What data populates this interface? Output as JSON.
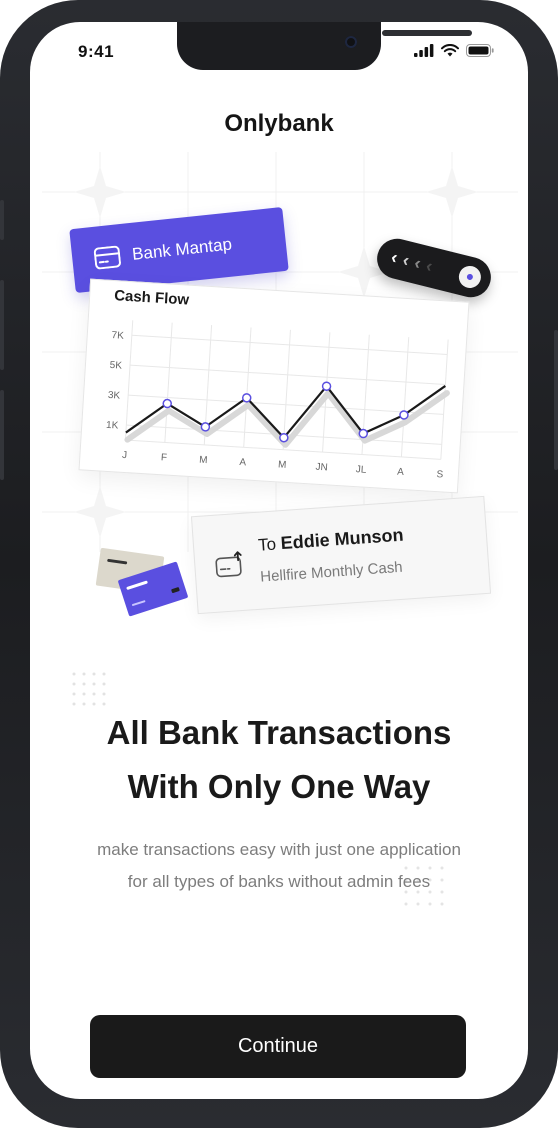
{
  "status_bar": {
    "time": "9:41"
  },
  "app": {
    "title": "Onlybank"
  },
  "bank_card": {
    "label": "Bank Mantap"
  },
  "cash_flow": {
    "title": "Cash Flow"
  },
  "transfer": {
    "prefix": "To",
    "name": "Eddie Munson",
    "note": "Hellfire Monthly Cash"
  },
  "onboarding": {
    "headline_line1": "All Bank Transactions",
    "headline_line2": "With Only One Way",
    "subtext_line1": "make transactions easy with just one application",
    "subtext_line2": "for all types of banks without admin fees",
    "continue_label": "Continue"
  },
  "colors": {
    "accent": "#5a4fe0",
    "button": "#1a1a1a",
    "text": "#1a1a1a",
    "muted": "#7d7d7d"
  },
  "chart_data": {
    "type": "line",
    "title": "Cash Flow",
    "categories": [
      "J",
      "F",
      "M",
      "A",
      "M",
      "JN",
      "JL",
      "A",
      "S"
    ],
    "y_tick_labels": [
      "7K",
      "5K",
      "3K",
      "1K"
    ],
    "values": [
      0.5,
      2.6,
      1.2,
      3.3,
      0.8,
      4.4,
      1.4,
      2.8,
      4.9
    ],
    "ylim": [
      0,
      8
    ],
    "grid": true
  }
}
